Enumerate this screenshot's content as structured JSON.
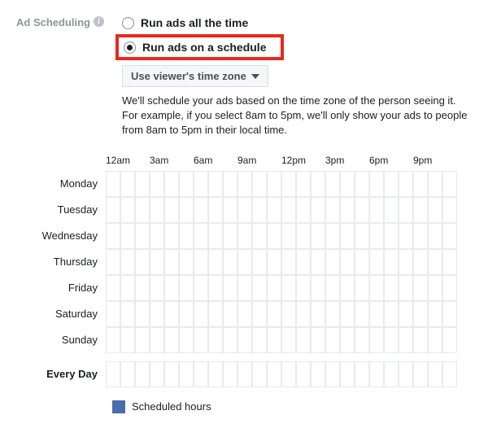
{
  "section_label": "Ad Scheduling",
  "radios": {
    "all_time": "Run ads all the time",
    "on_schedule": "Run ads on a schedule"
  },
  "timezone_select": "Use viewer's time zone",
  "help_line1": "We'll schedule your ads based on the time zone of the person seeing it.",
  "help_line2": "For example, if you select 8am to 5pm, we'll only show your ads to people from 8am to 5pm in their local time.",
  "hour_headers": [
    "12am",
    "3am",
    "6am",
    "9am",
    "12pm",
    "3pm",
    "6pm",
    "9pm"
  ],
  "days": [
    "Monday",
    "Tuesday",
    "Wednesday",
    "Thursday",
    "Friday",
    "Saturday",
    "Sunday"
  ],
  "every_day_label": "Every Day",
  "legend_label": "Scheduled hours"
}
